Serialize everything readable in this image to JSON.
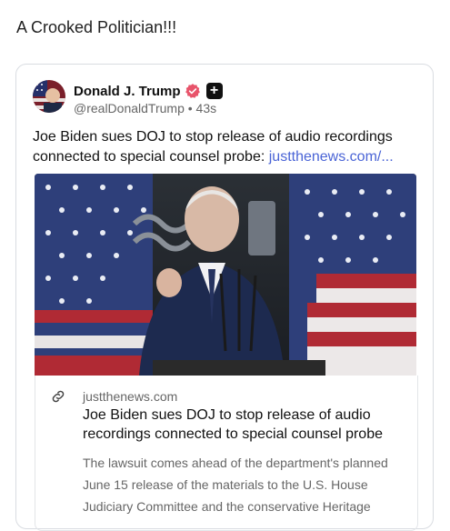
{
  "header": {
    "text": "A Crooked Politician!!!"
  },
  "post": {
    "author_name": "Donald J. Trump",
    "handle": "@realDonaldTrump",
    "separator": "•",
    "time": "43s",
    "text": "Joe Biden sues DOJ to stop release of audio recordings connected to special counsel probe: ",
    "link_text": "justthenews.com/..."
  },
  "link_card": {
    "domain": "justthenews.com",
    "title": "Joe Biden sues DOJ to stop release of audio recordings connected to special counsel probe",
    "description": "The lawsuit comes ahead of the department's planned June 15 release of the materials to the U.S. House Judiciary Committee and the conservative Heritage"
  },
  "colors": {
    "link": "#4a64d6",
    "verified": "#e8546b",
    "text_muted": "#666666"
  },
  "icons": {
    "verified": "verified-badge-icon",
    "plus": "plus-icon",
    "link": "link-icon"
  }
}
